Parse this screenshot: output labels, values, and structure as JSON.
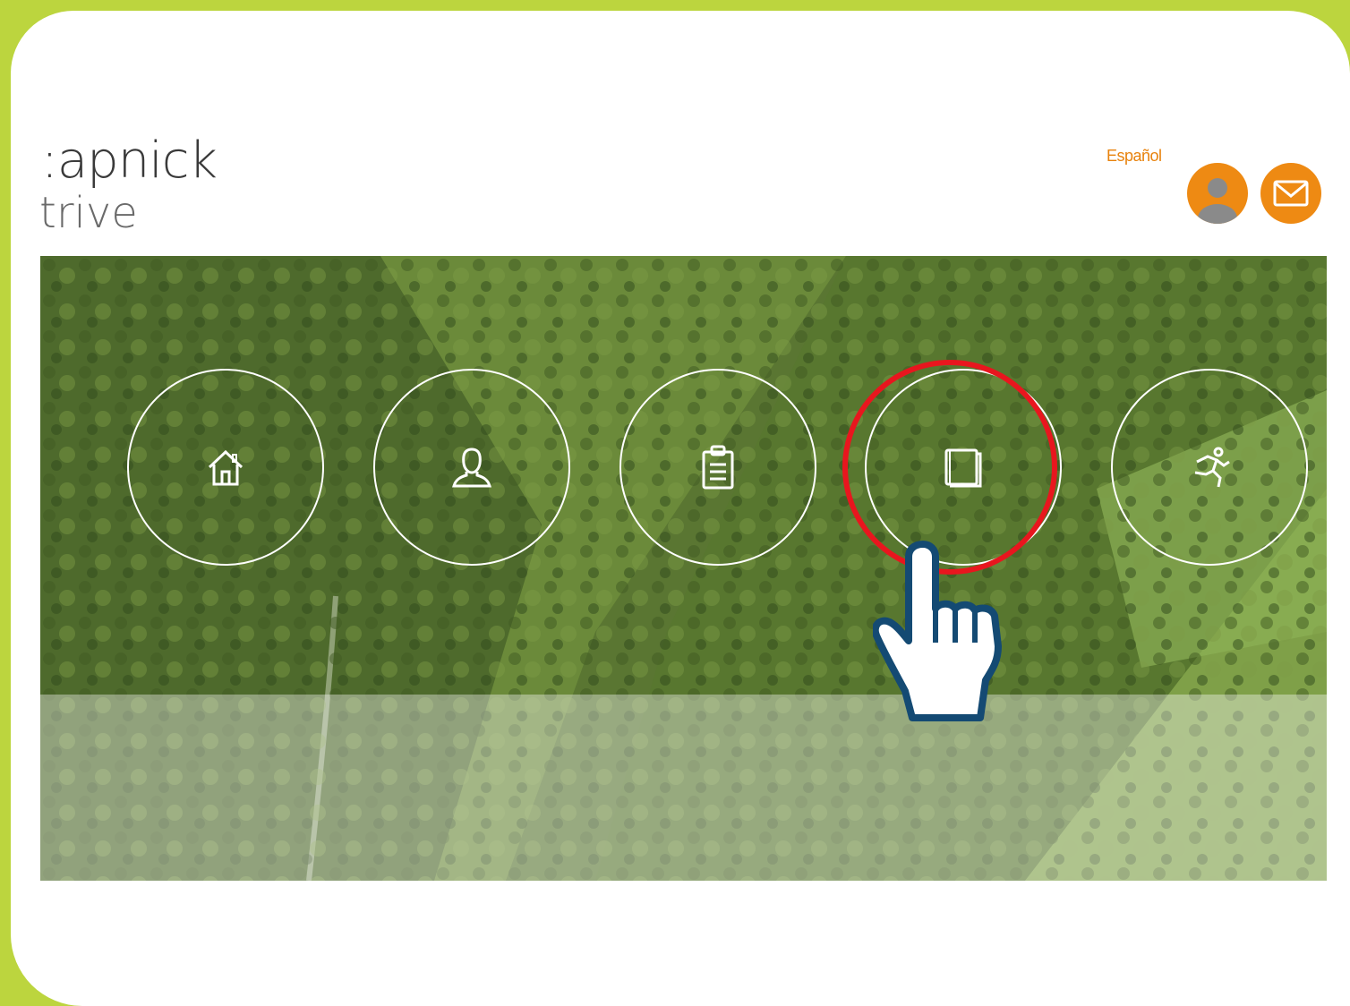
{
  "brand": {
    "line1": ":apnick",
    "line2": "trive"
  },
  "header": {
    "language_link": "Español",
    "profile_button": "user-profile",
    "mail_button": "messages"
  },
  "nav": {
    "items": [
      {
        "icon": "home-icon"
      },
      {
        "icon": "user-icon"
      },
      {
        "icon": "clipboard-icon"
      },
      {
        "icon": "book-icon",
        "highlighted": true
      },
      {
        "icon": "running-person-icon"
      }
    ]
  },
  "colors": {
    "frame": "#bcd53e",
    "accent": "#ee8a13",
    "highlight": "#e8161e",
    "hand_outline": "#144a73"
  }
}
